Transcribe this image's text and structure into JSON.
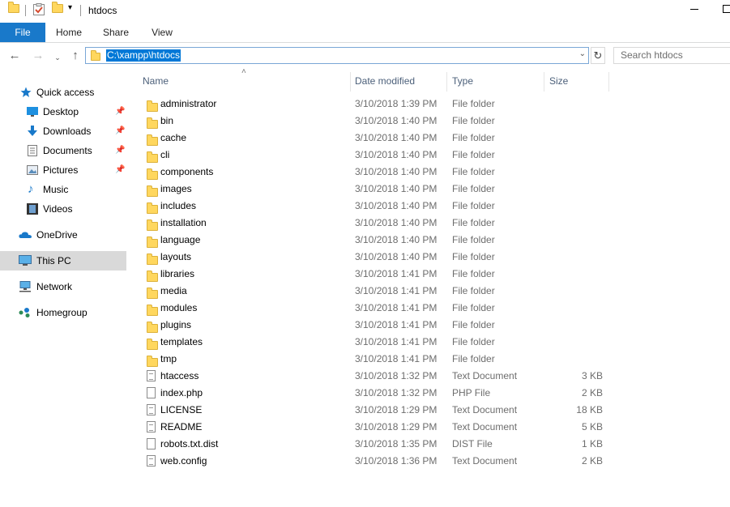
{
  "window": {
    "title": "htdocs",
    "quick_access_toolbar": [
      "folder-icon",
      "properties-icon",
      "new-folder-icon",
      "customize-dropdown-icon"
    ]
  },
  "ribbon": {
    "tabs": [
      "File",
      "Home",
      "Share",
      "View"
    ],
    "active": "File"
  },
  "address": {
    "path": "C:\\xampp\\htdocs",
    "search_placeholder": "Search htdocs"
  },
  "nav": {
    "items": [
      {
        "label": "Quick access",
        "icon": "star-icon"
      },
      {
        "label": "Desktop",
        "icon": "desktop-icon",
        "pinned": true
      },
      {
        "label": "Downloads",
        "icon": "download-icon",
        "pinned": true
      },
      {
        "label": "Documents",
        "icon": "documents-icon",
        "pinned": true
      },
      {
        "label": "Pictures",
        "icon": "pictures-icon",
        "pinned": true
      },
      {
        "label": "Music",
        "icon": "music-icon"
      },
      {
        "label": "Videos",
        "icon": "videos-icon"
      },
      {
        "label": "OneDrive",
        "icon": "cloud-icon"
      },
      {
        "label": "This PC",
        "icon": "computer-icon",
        "selected": true
      },
      {
        "label": "Network",
        "icon": "network-icon"
      },
      {
        "label": "Homegroup",
        "icon": "homegroup-icon"
      }
    ]
  },
  "columns": {
    "name": "Name",
    "date": "Date modified",
    "type": "Type",
    "size": "Size"
  },
  "files": [
    {
      "name": "administrator",
      "date": "3/10/2018 1:39 PM",
      "type": "File folder",
      "size": "",
      "kind": "folder"
    },
    {
      "name": "bin",
      "date": "3/10/2018 1:40 PM",
      "type": "File folder",
      "size": "",
      "kind": "folder"
    },
    {
      "name": "cache",
      "date": "3/10/2018 1:40 PM",
      "type": "File folder",
      "size": "",
      "kind": "folder"
    },
    {
      "name": "cli",
      "date": "3/10/2018 1:40 PM",
      "type": "File folder",
      "size": "",
      "kind": "folder"
    },
    {
      "name": "components",
      "date": "3/10/2018 1:40 PM",
      "type": "File folder",
      "size": "",
      "kind": "folder"
    },
    {
      "name": "images",
      "date": "3/10/2018 1:40 PM",
      "type": "File folder",
      "size": "",
      "kind": "folder"
    },
    {
      "name": "includes",
      "date": "3/10/2018 1:40 PM",
      "type": "File folder",
      "size": "",
      "kind": "folder"
    },
    {
      "name": "installation",
      "date": "3/10/2018 1:40 PM",
      "type": "File folder",
      "size": "",
      "kind": "folder"
    },
    {
      "name": "language",
      "date": "3/10/2018 1:40 PM",
      "type": "File folder",
      "size": "",
      "kind": "folder"
    },
    {
      "name": "layouts",
      "date": "3/10/2018 1:40 PM",
      "type": "File folder",
      "size": "",
      "kind": "folder"
    },
    {
      "name": "libraries",
      "date": "3/10/2018 1:41 PM",
      "type": "File folder",
      "size": "",
      "kind": "folder"
    },
    {
      "name": "media",
      "date": "3/10/2018 1:41 PM",
      "type": "File folder",
      "size": "",
      "kind": "folder"
    },
    {
      "name": "modules",
      "date": "3/10/2018 1:41 PM",
      "type": "File folder",
      "size": "",
      "kind": "folder"
    },
    {
      "name": "plugins",
      "date": "3/10/2018 1:41 PM",
      "type": "File folder",
      "size": "",
      "kind": "folder"
    },
    {
      "name": "templates",
      "date": "3/10/2018 1:41 PM",
      "type": "File folder",
      "size": "",
      "kind": "folder"
    },
    {
      "name": "tmp",
      "date": "3/10/2018 1:41 PM",
      "type": "File folder",
      "size": "",
      "kind": "folder"
    },
    {
      "name": "htaccess",
      "date": "3/10/2018 1:32 PM",
      "type": "Text Document",
      "size": "3 KB",
      "kind": "text"
    },
    {
      "name": "index.php",
      "date": "3/10/2018 1:32 PM",
      "type": "PHP File",
      "size": "2 KB",
      "kind": "blank"
    },
    {
      "name": "LICENSE",
      "date": "3/10/2018 1:29 PM",
      "type": "Text Document",
      "size": "18 KB",
      "kind": "text"
    },
    {
      "name": "README",
      "date": "3/10/2018 1:29 PM",
      "type": "Text Document",
      "size": "5 KB",
      "kind": "text"
    },
    {
      "name": "robots.txt.dist",
      "date": "3/10/2018 1:35 PM",
      "type": "DIST File",
      "size": "1 KB",
      "kind": "blank"
    },
    {
      "name": "web.config",
      "date": "3/10/2018 1:36 PM",
      "type": "Text Document",
      "size": "2 KB",
      "kind": "text"
    }
  ],
  "colors": {
    "file_tab": "#1979ca",
    "selection": "#0078d7",
    "header_text": "#4c607a",
    "folder": "#ffd75e"
  }
}
